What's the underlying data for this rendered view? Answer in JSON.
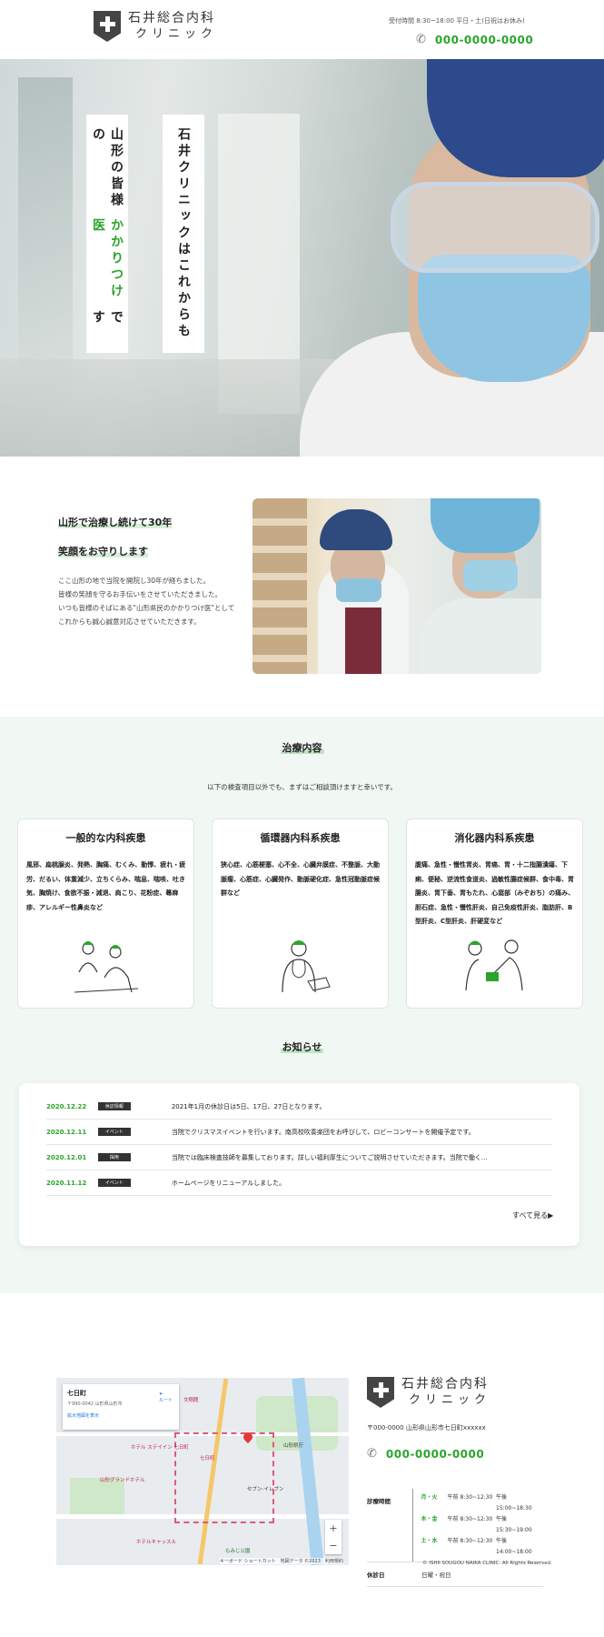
{
  "header": {
    "clinic_name_1": "石井総合内科",
    "clinic_name_2": "クリニック",
    "hours": "受付時間 8:30~18:00 平日・土(日祝はお休み)",
    "phone": "000-0000-0000"
  },
  "hero": {
    "line1": "石井クリニックはこれからも",
    "line2_a": "山形の皆様の",
    "line2_b": "かかりつけ医",
    "line2_c": "です"
  },
  "intro": {
    "heading1": "山形で治療し続けて30年",
    "heading2": "笑顔をお守りします",
    "p1": "ここ山形の地で当院を開院し30年が経ちました。",
    "p2": "皆様の笑顔を守るお手伝いをさせていただきました。",
    "p3": "いつも皆様のそばにある\"山形県民のかかりつけ医\"として",
    "p4": "これからも誠心誠意対応させていただきます。"
  },
  "services": {
    "title": "治療内容",
    "subtitle": "以下の検査項目以外でも、まずはご相談頂けますと幸いです。",
    "cards": [
      {
        "title": "一般的な内科疾患",
        "text": "風邪、扁桃腺炎、発熱、胸痛、むくみ、動悸、疲れ・疲労、だるい、体重減少、立ちくらみ、喘息、喘咳、吐き気、胸焼け、食欲不振・減退、肩こり、花粉症、蕁麻疹、アレルギー性鼻炎など"
      },
      {
        "title": "循環器内科系疾患",
        "text": "狭心症、心筋梗塞、心不全、心臓弁膜症、不整脈、大動脈瘤、心筋症、心臓発作、動脈硬化症、急性冠動脈症候群など"
      },
      {
        "title": "消化器内科系疾患",
        "text": "腹痛、急性・慢性胃炎、胃癌、胃・十二指腸潰瘍、下痢、便秘、逆流性食道炎、過敏性腸症候群、食中毒、胃腸炎、胃下垂、胃もたれ、心窩部（みぞおち）の痛み、胆石症、急性・慢性肝炎、自己免疫性肝炎、脂肪肝、B型肝炎、C型肝炎、肝硬変など"
      }
    ]
  },
  "news": {
    "title": "お知らせ",
    "items": [
      {
        "date": "2020.12.22",
        "tag": "休診情報",
        "text": "2021年1月の休診日は5日、17日、27日となります。"
      },
      {
        "date": "2020.12.11",
        "tag": "イベント",
        "text": "当院でクリスマスイベントを行います。南高校吹奏楽団をお呼びして、ロビーコンサートを開催予定です。"
      },
      {
        "date": "2020.12.01",
        "tag": "採用",
        "text": "当院では臨床検査技師を募集しております。詳しい福利厚生についてご説明させていただきます。当院で働く…"
      },
      {
        "date": "2020.11.12",
        "tag": "イベント",
        "text": "ホームページをリニューアルしました。"
      }
    ],
    "more": "すべて見る▶"
  },
  "map": {
    "place": "七日町",
    "address": "〒990-0042 山形県山形市",
    "enlarge": "拡大地図を表示",
    "route": "ルート",
    "labels": [
      "文翔館",
      "ホテル ステイイン 七日町",
      "七日町",
      "山形グランドホテル",
      "ホテルキャッスル",
      "セブン-イレブン",
      "山形県庁",
      "もみじ公園"
    ],
    "zoom_in": "+",
    "zoom_out": "−",
    "attribution": "キーボード ショートカット　地図データ ©2023　利用規約"
  },
  "footer": {
    "clinic_name_1": "石井総合内科",
    "clinic_name_2": "クリニック",
    "address": "〒000-0000 山形県山形市七日町xxxxxx",
    "phone": "000-0000-0000",
    "hours_label": "診療時間",
    "hours": [
      {
        "day": "月・火",
        "am": "午前 8:30~12:30",
        "pm": "午後 15:00~18:30"
      },
      {
        "day": "木・金",
        "am": "午前 8:30~12:30",
        "pm": "午後 15:30~19:00"
      },
      {
        "day": "土・水",
        "am": "午前 8:30~12:30",
        "pm": "午後 14:00~18:00"
      }
    ],
    "closed_label": "休診日",
    "closed": "日曜・祝日",
    "copyright": "© ISHII SOUGOU NAIKA CLINIC. All Rights Reserved."
  },
  "colors": {
    "accent": "#2ba42b",
    "section_bg": "#f1f8f3",
    "logo": "#444444"
  }
}
